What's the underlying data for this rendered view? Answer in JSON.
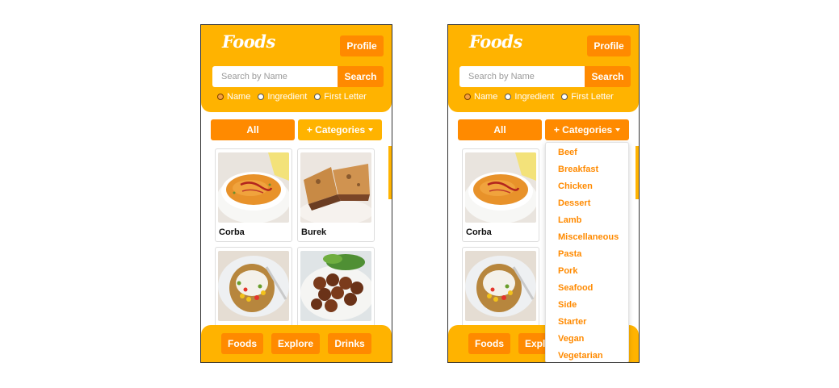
{
  "app": {
    "logo": "Foods",
    "profile_label": "Profile",
    "search": {
      "placeholder": "Search by Name",
      "button_label": "Search"
    },
    "search_options": [
      {
        "label": "Name",
        "checked": true
      },
      {
        "label": "Ingredient",
        "checked": false
      },
      {
        "label": "First Letter",
        "checked": false
      }
    ],
    "filter": {
      "all_label": "All",
      "categories_label": "+ Categories"
    },
    "cards": [
      {
        "name": "Corba",
        "image": "soup-photo"
      },
      {
        "name": "Burek",
        "image": "pastry-photo"
      },
      {
        "name": "",
        "image": "stuffed-potato-photo"
      },
      {
        "name": "",
        "image": "falafel-photo"
      }
    ],
    "footer": {
      "foods_label": "Foods",
      "explore_label": "Explore",
      "drinks_label": "Drinks"
    }
  },
  "dropdown": {
    "items": [
      "Beef",
      "Breakfast",
      "Chicken",
      "Dessert",
      "Lamb",
      "Miscellaneous",
      "Pasta",
      "Pork",
      "Seafood",
      "Side",
      "Starter",
      "Vegan",
      "Vegetarian"
    ]
  },
  "colors": {
    "header_yellow": "#ffb300",
    "button_orange": "#ff8a00",
    "dropdown_text": "#ff8a00"
  }
}
